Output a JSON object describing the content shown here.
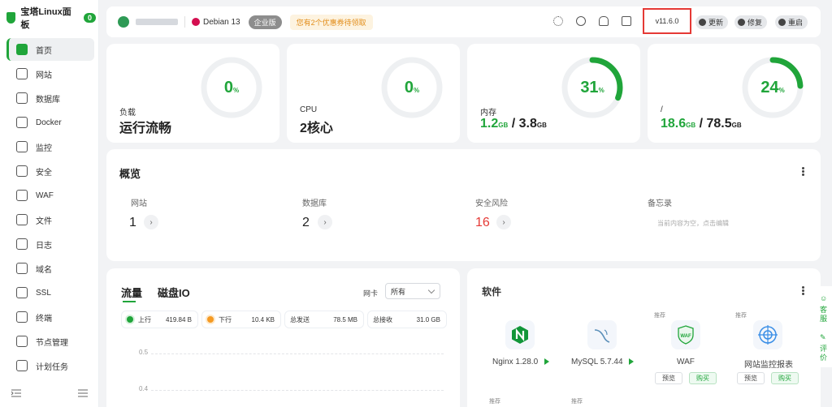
{
  "sidebar": {
    "brand": "宝塔Linux面板",
    "badge": "0",
    "items": [
      {
        "label": "首页",
        "icon": "home-icon"
      },
      {
        "label": "网站",
        "icon": "website-icon"
      },
      {
        "label": "数据库",
        "icon": "database-icon"
      },
      {
        "label": "Docker",
        "icon": "docker-icon"
      },
      {
        "label": "监控",
        "icon": "monitor-icon"
      },
      {
        "label": "安全",
        "icon": "shield-icon"
      },
      {
        "label": "WAF",
        "icon": "waf-icon"
      },
      {
        "label": "文件",
        "icon": "folder-icon"
      },
      {
        "label": "日志",
        "icon": "log-icon"
      },
      {
        "label": "域名",
        "icon": "domain-icon"
      },
      {
        "label": "SSL",
        "icon": "ssl-icon"
      },
      {
        "label": "终端",
        "icon": "terminal-icon"
      },
      {
        "label": "节点管理",
        "icon": "node-icon"
      },
      {
        "label": "计划任务",
        "icon": "calendar-icon"
      }
    ]
  },
  "topbar": {
    "os": "Debian 13",
    "edition": "企业版",
    "promo": "您有2个优惠券待领取",
    "version": "v11.6.0",
    "update": "更新",
    "repair": "修复",
    "restart": "重启"
  },
  "stats": {
    "load": {
      "label": "负载",
      "value": "运行流畅",
      "percent": 0,
      "unit": "%"
    },
    "cpu": {
      "label": "CPU",
      "value": "2核心",
      "percent": 0,
      "unit": "%"
    },
    "mem": {
      "label": "内存",
      "used": "1.2",
      "used_unit": "GB",
      "sep": "/",
      "total": "3.8",
      "total_unit": "GB",
      "percent": 31,
      "unit": "%"
    },
    "disk": {
      "label": "/",
      "used": "18.6",
      "used_unit": "GB",
      "sep": "/",
      "total": "78.5",
      "total_unit": "GB",
      "percent": 24,
      "unit": "%"
    }
  },
  "overview": {
    "title": "概览",
    "website": {
      "label": "网站",
      "value": "1"
    },
    "database": {
      "label": "数据库",
      "value": "2"
    },
    "risk": {
      "label": "安全风险",
      "value": "16"
    },
    "memo": {
      "label": "备忘录",
      "placeholder": "当前内容为空，点击编辑"
    },
    "arrow": "›"
  },
  "traffic": {
    "tab1": "流量",
    "tab2": "磁盘IO",
    "nic_label": "网卡",
    "nic_value": "所有",
    "up": {
      "label": "上行",
      "value": "419.84 B"
    },
    "down": {
      "label": "下行",
      "value": "10.4 KB"
    },
    "sent": {
      "label": "总发送",
      "value": "78.5 MB"
    },
    "recv": {
      "label": "总接收",
      "value": "31.0 GB"
    },
    "ticks": [
      "0.5",
      "0.4"
    ]
  },
  "software": {
    "title": "软件",
    "rec": "推荐",
    "preview": "预览",
    "buy": "购买",
    "items": [
      {
        "name": "Nginx 1.28.0"
      },
      {
        "name": "MySQL 5.7.44"
      },
      {
        "name": "WAF"
      },
      {
        "name": "网站监控报表"
      }
    ]
  },
  "float": {
    "service": "客服",
    "review": "评价"
  },
  "colors": {
    "accent": "#20a53a",
    "danger": "#e53935"
  }
}
